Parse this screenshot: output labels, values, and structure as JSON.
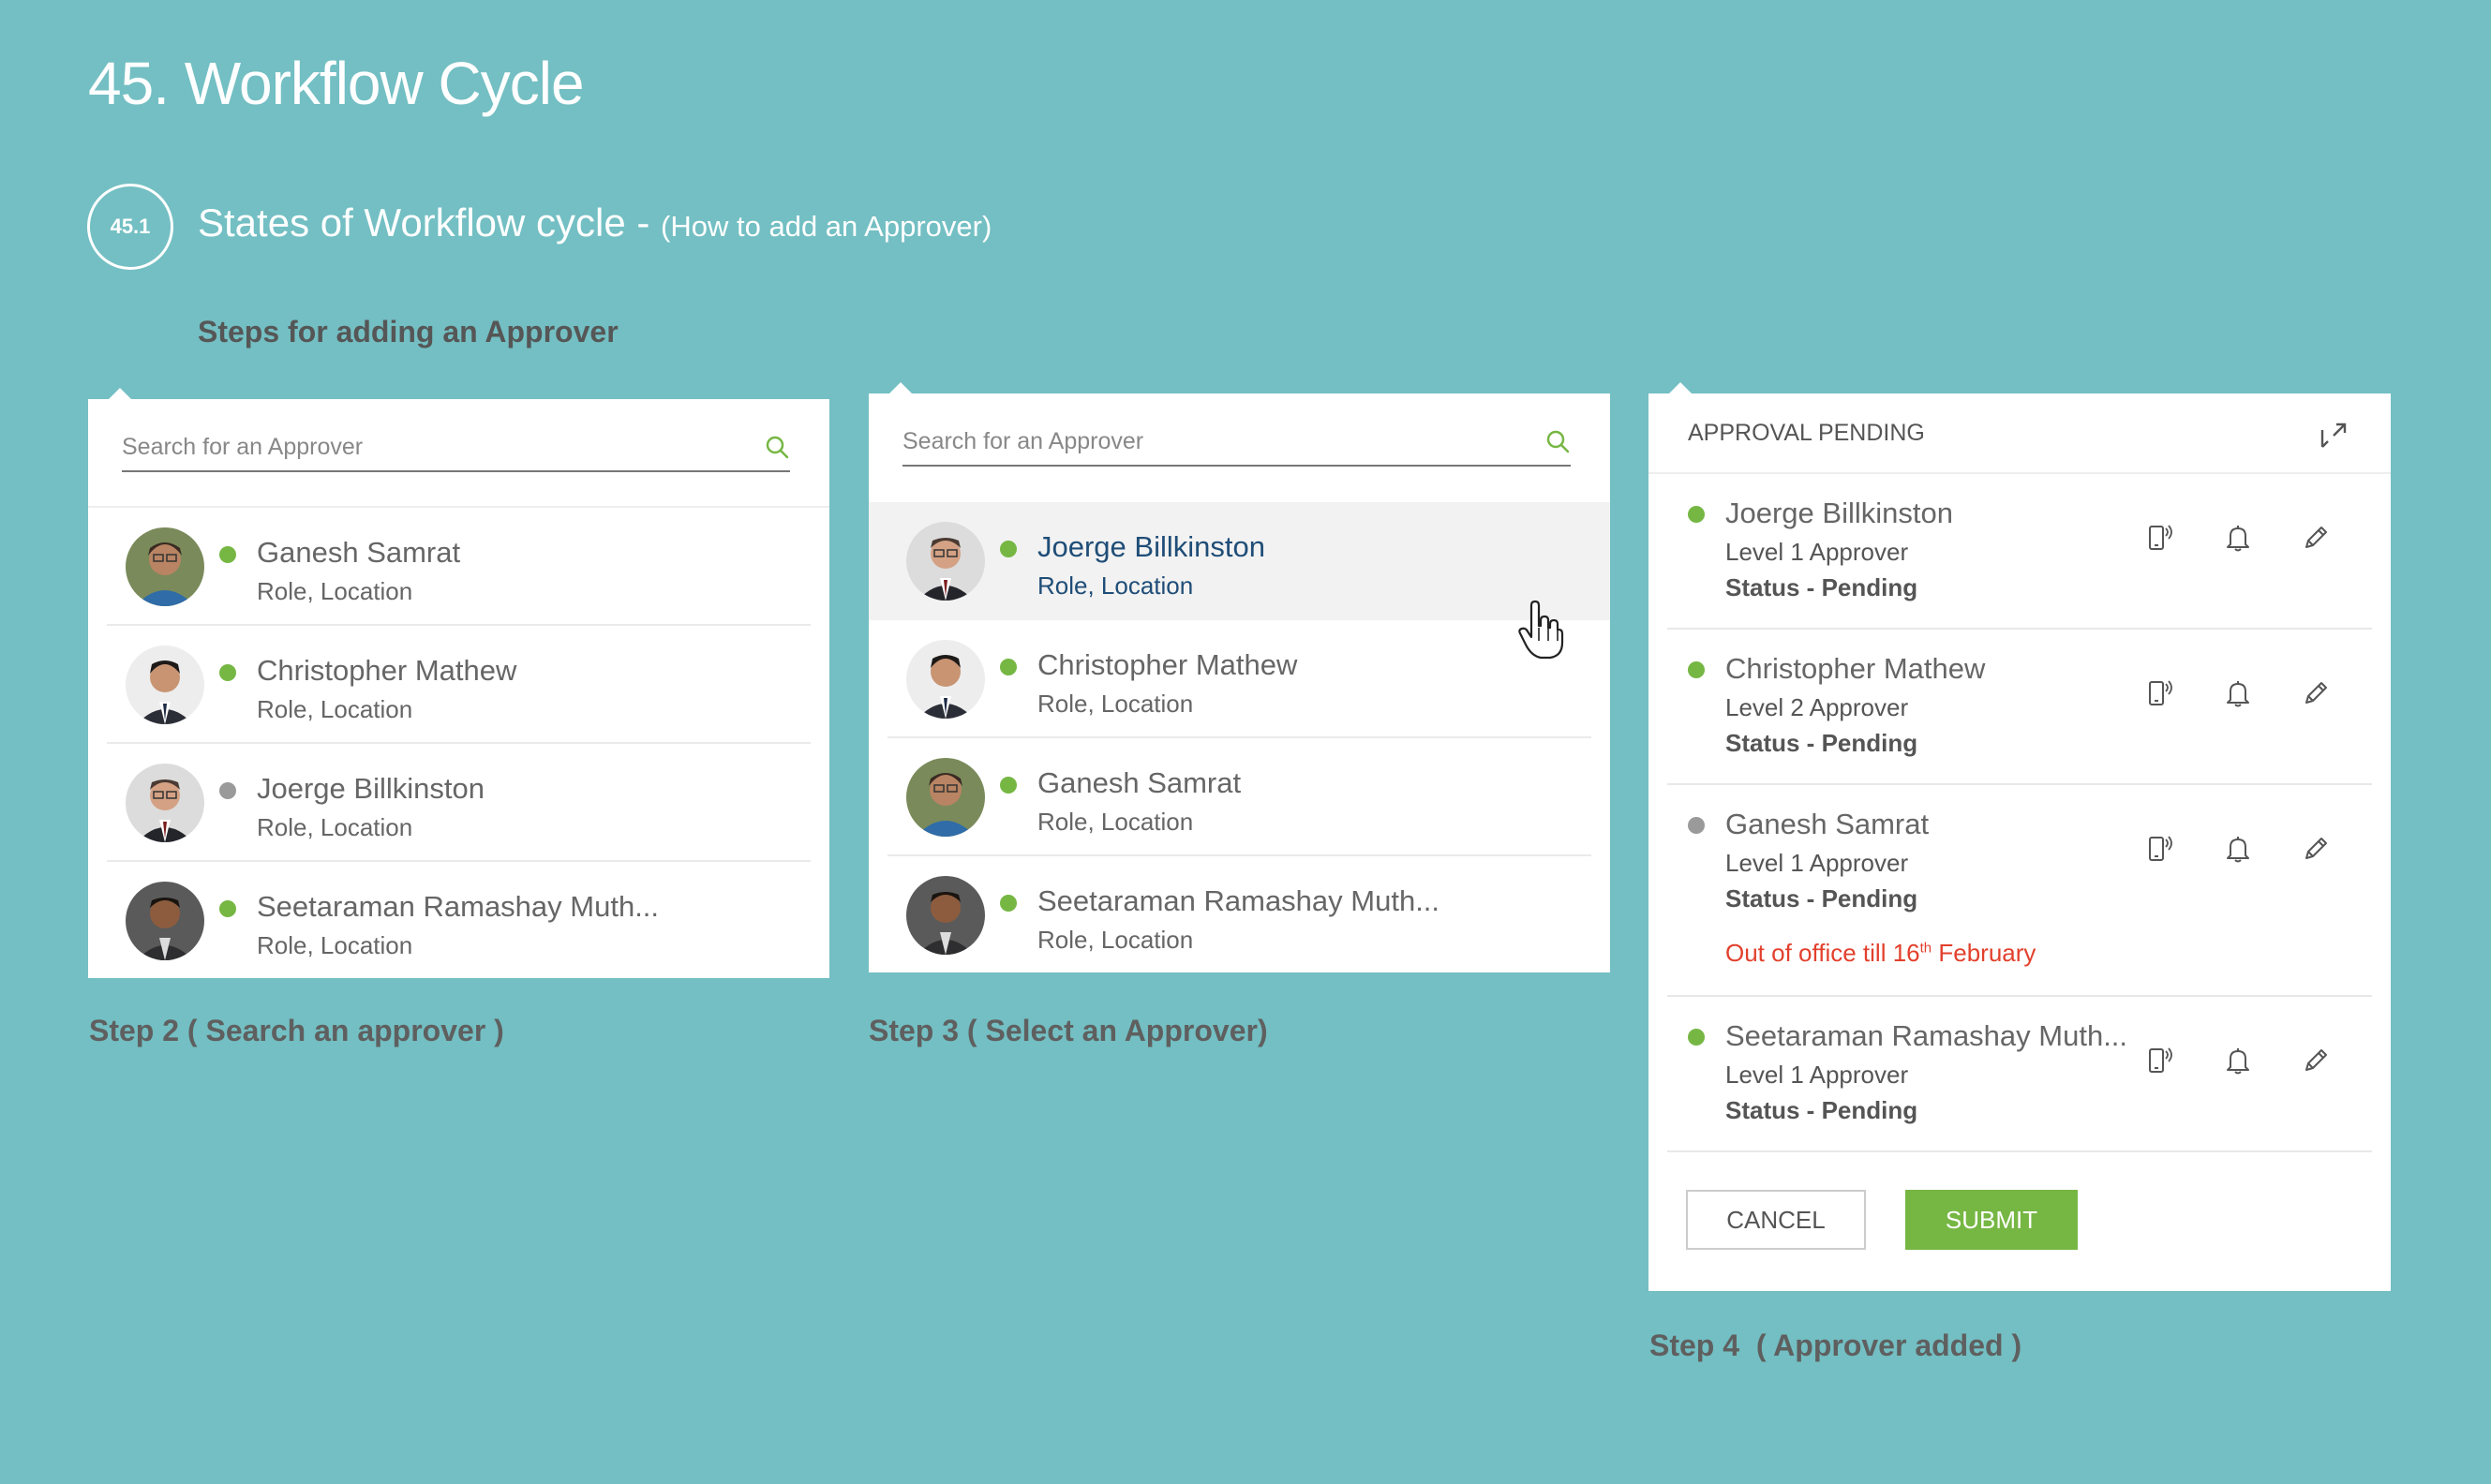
{
  "page_title": "45. Workflow Cycle",
  "section": {
    "number": "45.1",
    "title": "States of Workflow cycle -",
    "subtitle": "(How to add an Approver)",
    "steps_heading": "Steps for adding an Approver"
  },
  "panel1": {
    "search_placeholder": "Search for an Approver",
    "rows": [
      {
        "name": "Ganesh Samrat",
        "role": "Role, Location",
        "status": "online"
      },
      {
        "name": "Christopher Mathew",
        "role": "Role, Location",
        "status": "online"
      },
      {
        "name": "Joerge Billkinston",
        "role": "Role, Location",
        "status": "offline"
      },
      {
        "name": "Seetaraman Ramashay Muth...",
        "role": "Role, Location",
        "status": "online"
      }
    ],
    "caption": "Step 2 ( Search an approver )"
  },
  "panel2": {
    "search_placeholder": "Search for an Approver",
    "rows": [
      {
        "name": "Joerge Billkinston",
        "role": "Role, Location",
        "status": "online",
        "selected": true
      },
      {
        "name": "Christopher Mathew",
        "role": "Role, Location",
        "status": "online"
      },
      {
        "name": "Ganesh Samrat",
        "role": "Role, Location",
        "status": "online"
      },
      {
        "name": "Seetaraman Ramashay Muth...",
        "role": "Role, Location",
        "status": "online"
      }
    ],
    "caption": "Step 3 ( Select an Approver)"
  },
  "panel3": {
    "header": "APPROVAL PENDING",
    "approvers": [
      {
        "name": "Joerge Billkinston",
        "level": "Level 1 Approver",
        "status": "Status - Pending",
        "presence": "online"
      },
      {
        "name": "Christopher Mathew",
        "level": "Level 2 Approver",
        "status": "Status - Pending",
        "presence": "online"
      },
      {
        "name": "Ganesh Samrat",
        "level": "Level 1 Approver",
        "status": "Status - Pending",
        "presence": "offline",
        "note_pre": "Out of office till 16",
        "note_sup": "th",
        "note_post": " February"
      },
      {
        "name": "Seetaraman Ramashay Muth...",
        "level": "Level 1 Approver",
        "status": "Status - Pending",
        "presence": "online"
      }
    ],
    "cancel_label": "CANCEL",
    "submit_label": "SUBMIT",
    "caption": "Step 4  ( Approver added )"
  },
  "colors": {
    "background": "#73bfc3",
    "online": "#76b744",
    "offline": "#9a9a9a",
    "accent_text": "#1f4d77",
    "warning": "#e2402c"
  },
  "icons": [
    "search-icon",
    "pointer-cursor-icon",
    "expand-icon",
    "mobile-icon",
    "bell-icon",
    "edit-icon"
  ]
}
